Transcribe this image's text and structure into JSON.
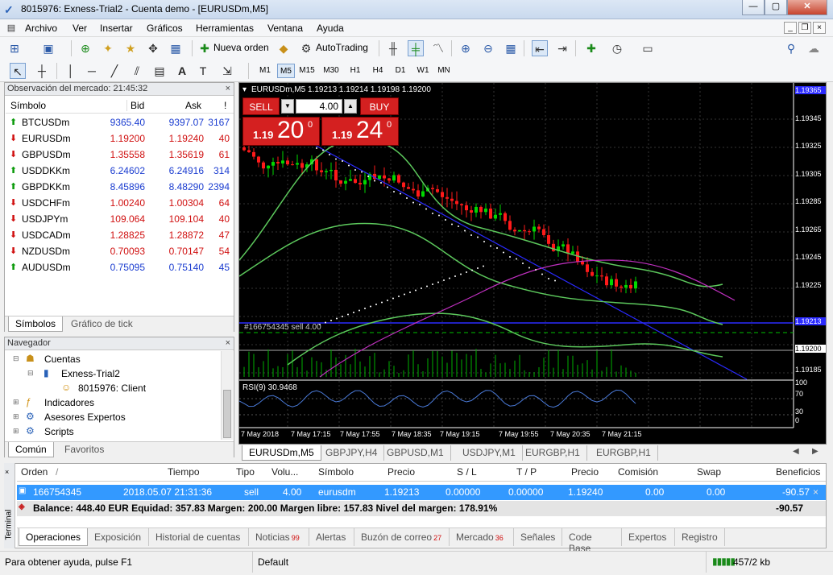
{
  "window": {
    "title": "8015976: Exness-Trial2 - Cuenta demo - [EURUSDm,M5]"
  },
  "menu": [
    "Archivo",
    "Ver",
    "Insertar",
    "Gráficos",
    "Herramientas",
    "Ventana",
    "Ayuda"
  ],
  "toolbar": {
    "new_order": "Nueva orden",
    "autotrading": "AutoTrading"
  },
  "timeframes": [
    "M1",
    "M5",
    "M15",
    "M30",
    "H1",
    "H4",
    "D1",
    "W1",
    "MN"
  ],
  "timeframe_active": "M5",
  "market_watch": {
    "title": "Observación del mercado: 21:45:32",
    "headers": {
      "symbol": "Símbolo",
      "bid": "Bid",
      "ask": "Ask",
      "spread": "!"
    },
    "rows": [
      {
        "symbol": "BTCUSDm",
        "bid": "9365.40",
        "ask": "9397.07",
        "spread": "3167",
        "dir": "up",
        "color": "blue"
      },
      {
        "symbol": "EURUSDm",
        "bid": "1.19200",
        "ask": "1.19240",
        "spread": "40",
        "dir": "down",
        "color": "red"
      },
      {
        "symbol": "GBPUSDm",
        "bid": "1.35558",
        "ask": "1.35619",
        "spread": "61",
        "dir": "down",
        "color": "red"
      },
      {
        "symbol": "USDDKKm",
        "bid": "6.24602",
        "ask": "6.24916",
        "spread": "314",
        "dir": "up",
        "color": "blue"
      },
      {
        "symbol": "GBPDKKm",
        "bid": "8.45896",
        "ask": "8.48290",
        "spread": "2394",
        "dir": "up",
        "color": "blue"
      },
      {
        "symbol": "USDCHFm",
        "bid": "1.00240",
        "ask": "1.00304",
        "spread": "64",
        "dir": "down",
        "color": "red"
      },
      {
        "symbol": "USDJPYm",
        "bid": "109.064",
        "ask": "109.104",
        "spread": "40",
        "dir": "down",
        "color": "red"
      },
      {
        "symbol": "USDCADm",
        "bid": "1.28825",
        "ask": "1.28872",
        "spread": "47",
        "dir": "down",
        "color": "red"
      },
      {
        "symbol": "NZDUSDm",
        "bid": "0.70093",
        "ask": "0.70147",
        "spread": "54",
        "dir": "down",
        "color": "red"
      },
      {
        "symbol": "AUDUSDm",
        "bid": "0.75095",
        "ask": "0.75140",
        "spread": "45",
        "dir": "up",
        "color": "blue"
      }
    ],
    "tabs": [
      "Símbolos",
      "Gráfico de tick"
    ]
  },
  "navigator": {
    "title": "Navegador",
    "items": {
      "accounts": "Cuentas",
      "server": "Exness-Trial2",
      "client": "8015976: Client",
      "indicators": "Indicadores",
      "experts": "Asesores Expertos",
      "scripts": "Scripts"
    },
    "tabs": [
      "Común",
      "Favoritos"
    ]
  },
  "chart": {
    "header": "EURUSDm,M5  1.19213 1.19214 1.19198 1.19200",
    "sell_label": "SELL",
    "buy_label": "BUY",
    "lot": "4.00",
    "sell_price_small": "1.19",
    "sell_price_big": "20",
    "sell_price_sup": "0",
    "buy_price_small": "1.19",
    "buy_price_big": "24",
    "buy_price_sup": "0",
    "order_line_label": "#166754345 sell 4.00",
    "rsi_label": "RSI(9) 30.9468",
    "price_axis": [
      "1.19365",
      "1.19345",
      "1.19325",
      "1.19305",
      "1.19285",
      "1.19265",
      "1.19245",
      "1.19225",
      "1.19213",
      "1.19200",
      "1.19185"
    ],
    "rsi_axis": [
      "100",
      "70",
      "30",
      "0"
    ],
    "time_axis": [
      "7 May 2018",
      "7 May 17:15",
      "7 May 17:55",
      "7 May 18:35",
      "7 May 19:15",
      "7 May 19:55",
      "7 May 20:35",
      "7 May 21:15"
    ]
  },
  "chart_tabs": [
    "EURUSDm,M5",
    "GBPJPY,H4",
    "GBPUSD,M1",
    "USDJPY,M1",
    "EURGBP,H1",
    "EURGBP,H1"
  ],
  "terminal": {
    "side_label": "Terminal",
    "headers": [
      "Orden",
      "Tiempo",
      "Tipo",
      "Volu...",
      "Símbolo",
      "Precio",
      "S / L",
      "T / P",
      "Precio",
      "Comisión",
      "Swap",
      "Beneficios"
    ],
    "order": {
      "id": "166754345",
      "time": "2018.05.07 21:31:36",
      "type": "sell",
      "volume": "4.00",
      "symbol": "eurusdm",
      "price": "1.19213",
      "sl": "0.00000",
      "tp": "0.00000",
      "current": "1.19240",
      "commission": "0.00",
      "swap": "0.00",
      "profit": "-90.57"
    },
    "balance_text": "Balance: 448.40 EUR  Equidad: 357.83  Margen: 200.00  Margen libre: 157.83  Nivel del margen: 178.91%",
    "balance_profit": "-90.57",
    "tabs": [
      {
        "label": "Operaciones",
        "badge": ""
      },
      {
        "label": "Exposición",
        "badge": ""
      },
      {
        "label": "Historial de cuentas",
        "badge": ""
      },
      {
        "label": "Noticias",
        "badge": "99"
      },
      {
        "label": "Alertas",
        "badge": ""
      },
      {
        "label": "Buzón de correo",
        "badge": "27"
      },
      {
        "label": "Mercado",
        "badge": "36"
      },
      {
        "label": "Señales",
        "badge": ""
      },
      {
        "label": "Code Base",
        "badge": ""
      },
      {
        "label": "Expertos",
        "badge": ""
      },
      {
        "label": "Registro",
        "badge": ""
      }
    ]
  },
  "status": {
    "help": "Para obtener ayuda, pulse F1",
    "profile": "Default",
    "traffic": "457/2 kb"
  },
  "colors": {
    "bull": "#00d800",
    "bear": "#ff1a1a",
    "trend": "#2a2aff",
    "bands": "#5cc85c",
    "ma": "#c030c0",
    "sellbtn": "#d42020",
    "selrow": "#3399ff"
  }
}
